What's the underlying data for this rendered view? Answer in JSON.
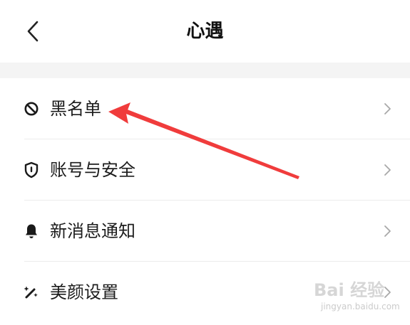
{
  "header": {
    "title": "心遇",
    "back_icon": "chevron-left-icon"
  },
  "settings": {
    "items": [
      {
        "label": "黑名单",
        "icon": "block-icon"
      },
      {
        "label": "账号与安全",
        "icon": "shield-icon"
      },
      {
        "label": "新消息通知",
        "icon": "bell-icon"
      },
      {
        "label": "美颜设置",
        "icon": "beauty-wand-icon"
      }
    ],
    "trailing_icon": "chevron-right-icon"
  },
  "annotation": {
    "type": "red-arrow",
    "target": "黑名单",
    "color": "#f03c3c"
  },
  "watermark": {
    "main": "Bai 经验",
    "sub": "jingyan.baidu.com"
  }
}
